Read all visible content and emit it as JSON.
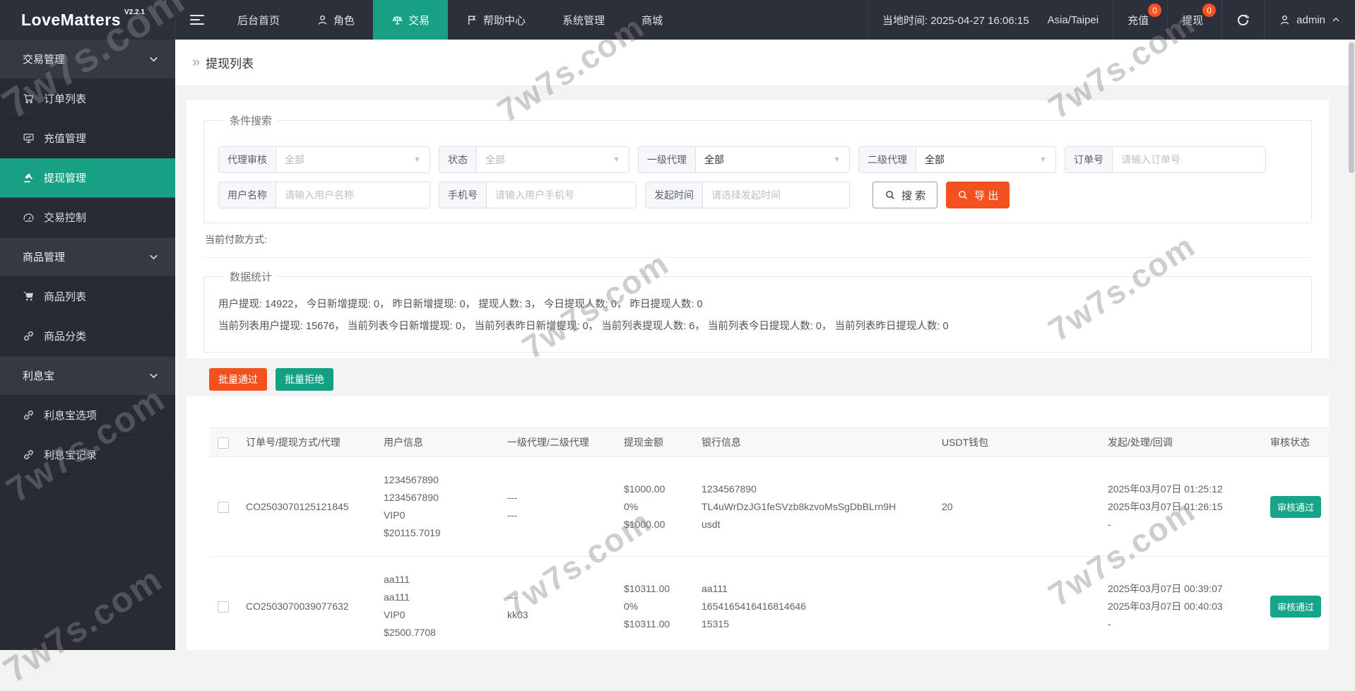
{
  "navbar": {
    "logo": "LoveMatters",
    "version": "V2.2.1",
    "items": [
      {
        "label": "后台首页"
      },
      {
        "label": "角色",
        "icon": "person-icon"
      },
      {
        "label": "交易",
        "icon": "scales-icon",
        "active": true
      },
      {
        "label": "帮助中心",
        "icon": "flag-icon"
      },
      {
        "label": "系统管理"
      },
      {
        "label": "商城"
      }
    ],
    "local_time": "当地时间: 2025-04-27 16:06:15",
    "timezone": "Asia/Taipei",
    "recharge_label": "充值",
    "recharge_badge": "0",
    "withdraw_label": "提现",
    "withdraw_badge": "0",
    "user": "admin"
  },
  "sidebar": {
    "groups": [
      {
        "label": "交易管理",
        "items": [
          {
            "label": "订单列表",
            "icon": "cart-icon"
          },
          {
            "label": "充值管理",
            "icon": "board-icon"
          },
          {
            "label": "提现管理",
            "icon": "gavel-icon",
            "active": true
          },
          {
            "label": "交易控制",
            "icon": "gauge-icon"
          }
        ]
      },
      {
        "label": "商品管理",
        "items": [
          {
            "label": "商品列表",
            "icon": "cart-filled-icon"
          },
          {
            "label": "商品分类",
            "icon": "link-icon"
          }
        ]
      },
      {
        "label": "利息宝",
        "items": [
          {
            "label": "利息宝选项",
            "icon": "link-icon"
          },
          {
            "label": "利息宝记录",
            "icon": "link-icon"
          }
        ]
      }
    ]
  },
  "breadcrumb": {
    "chevrons": "»",
    "title": "提现列表"
  },
  "filters": {
    "legend": "条件搜索",
    "row1": [
      {
        "label": "代理审核",
        "value": "全部"
      },
      {
        "label": "状态",
        "value": "全部"
      },
      {
        "label": "一级代理",
        "value": "全部"
      },
      {
        "label": "二级代理",
        "value": "全部"
      },
      {
        "label": "订单号",
        "placeholder": "请输入订单号"
      }
    ],
    "row2": [
      {
        "label": "用户名称",
        "placeholder": "请输入用户名称"
      },
      {
        "label": "手机号",
        "placeholder": "请输入用户手机号"
      },
      {
        "label": "发起时间",
        "placeholder": "请选择发起时间"
      }
    ],
    "search_label": "搜 索",
    "export_label": "导 出"
  },
  "payment_line": "当前付款方式:",
  "stats": {
    "legend": "数据统计",
    "line1": "用户提现: 14922， 今日新增提现: 0， 昨日新增提现: 0， 提现人数: 3， 今日提现人数: 0， 昨日提现人数: 0",
    "line2": "当前列表用户提现: 15676， 当前列表今日新增提现: 0， 当前列表昨日新增提现: 0， 当前列表提现人数: 6， 当前列表今日提现人数: 0， 当前列表昨日提现人数: 0"
  },
  "batch": {
    "approve": "批量通过",
    "reject": "批量拒绝"
  },
  "table": {
    "headers": [
      "订单号/提现方式/代理",
      "用户信息",
      "一级代理/二级代理",
      "提现金额",
      "银行信息",
      "USDT钱包",
      "发起/处理/回调",
      "审核状态"
    ],
    "rows": [
      {
        "order": "CO2503070125121845",
        "user": [
          "1234567890",
          "1234567890",
          "VIP0",
          "$20115.7019"
        ],
        "agent": [
          "---",
          "---"
        ],
        "amount": [
          "$1000.00",
          "0%",
          "$1000.00"
        ],
        "bank": [
          "1234567890",
          "TL4uWrDzJG1feSVzb8kzvoMsSgDbBLrn9H",
          "usdt"
        ],
        "usdt": "20",
        "times": [
          "2025年03月07日 01:25:12",
          "2025年03月07日 01:26:15",
          "-"
        ],
        "status": "审核通过"
      },
      {
        "order": "CO2503070039077632",
        "user": [
          "aa111",
          "aa111",
          "VIP0",
          "$2500.7708"
        ],
        "agent": [
          "---",
          "kk03"
        ],
        "amount": [
          "$10311.00",
          "0%",
          "$10311.00"
        ],
        "bank": [
          "aa111",
          "1654165416416814646",
          "15315"
        ],
        "usdt": "",
        "times": [
          "2025年03月07日 00:39:07",
          "2025年03月07日 00:40:03",
          "-"
        ],
        "status": "审核通过"
      }
    ]
  },
  "watermark": {
    "text": "7w7s.com"
  },
  "colors": {
    "accent": "#17a084",
    "orange": "#f4511e",
    "status_green": "#16a58a",
    "navbar_bg": "#2c303a"
  }
}
